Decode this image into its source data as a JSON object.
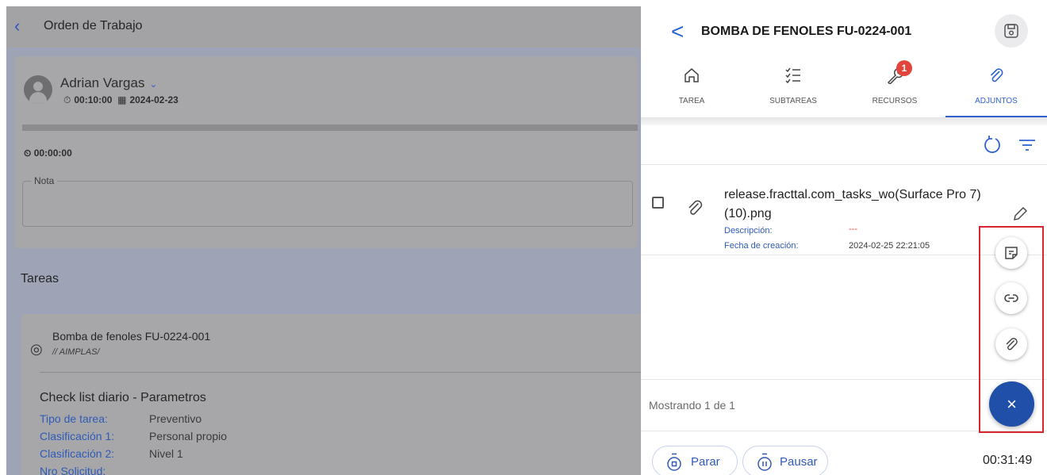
{
  "background_app": {
    "header": {
      "back_glyph": "‹",
      "title": "Orden de Trabajo"
    },
    "user": {
      "name": "Adrian Vargas",
      "duration": "00:10:00",
      "date": "2024-02-23",
      "timer": "00:00:00"
    },
    "note": {
      "label": "Nota"
    },
    "tasks_heading": "Tareas",
    "task": {
      "name": "Bomba de fenoles FU-0224-001",
      "path": "// AIMPLAS/",
      "checklist_title": "Check list diario - Parametros",
      "fields": [
        {
          "label": "Tipo de tarea:",
          "value": "Preventivo"
        },
        {
          "label": "Clasificación 1:",
          "value": "Personal propio"
        },
        {
          "label": "Clasificación 2:",
          "value": "Nivel 1"
        },
        {
          "label": "Nro Solicitud:",
          "value": ""
        }
      ]
    }
  },
  "panel": {
    "title": "BOMBA DE FENOLES FU-0224-001",
    "tabs": [
      {
        "label": "TAREA",
        "icon": "home-icon",
        "active": false
      },
      {
        "label": "SUBTAREAS",
        "icon": "checklist-icon",
        "active": false
      },
      {
        "label": "RECURSOS",
        "icon": "wrench-icon",
        "active": false,
        "badge": "1"
      },
      {
        "label": "ADJUNTOS",
        "icon": "paperclip-icon",
        "active": true
      }
    ],
    "attachment": {
      "filename": "release.fracttal.com_tasks_wo(Surface Pro 7) (10).png",
      "description_label": "Descripción:",
      "description_value": "---",
      "created_label": "Fecha de creación:",
      "created_value": "2024-02-25 22:21:05"
    },
    "count_text": "Mostrando 1 de 1",
    "buttons": {
      "stop": "Parar",
      "pause": "Pausar"
    },
    "elapsed": "00:31:49",
    "fab": {
      "close_glyph": "×",
      "options": [
        "note-icon",
        "link-icon",
        "paperclip-icon"
      ]
    },
    "colors": {
      "accent": "#2f62d0",
      "fab": "#1f4fa8",
      "badge": "#e2453c",
      "highlight": "#d8262e"
    }
  }
}
